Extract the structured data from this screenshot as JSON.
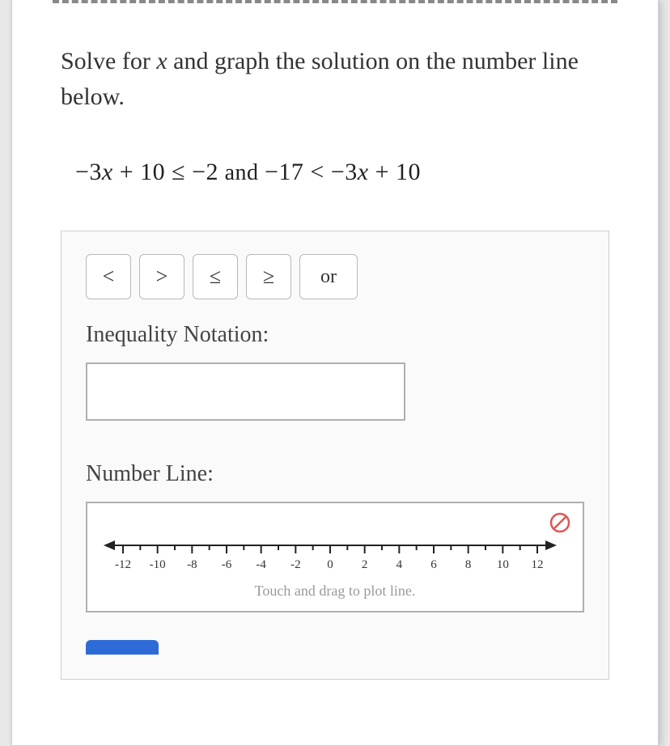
{
  "prompt": {
    "line1_pre": "Solve for ",
    "var": "x",
    "line1_post": " and graph the solution on the number line below."
  },
  "equation": {
    "part1_pre": "−3",
    "part1_var": "x",
    "part1_mid": " + 10 ≤ −2",
    "conj": "  and  ",
    "part2_pre": "−17 < −3",
    "part2_var": "x",
    "part2_post": " + 10"
  },
  "operators": {
    "lt": "<",
    "gt": ">",
    "le": "≤",
    "ge": "≥",
    "or": "or"
  },
  "labels": {
    "inequality": "Inequality Notation:",
    "numberline": "Number Line:",
    "hint": "Touch and drag to plot line."
  },
  "input": {
    "value": ""
  },
  "numberline": {
    "ticks": [
      "-12",
      "-10",
      "-8",
      "-6",
      "-4",
      "-2",
      "0",
      "2",
      "4",
      "6",
      "8",
      "10",
      "12"
    ]
  }
}
